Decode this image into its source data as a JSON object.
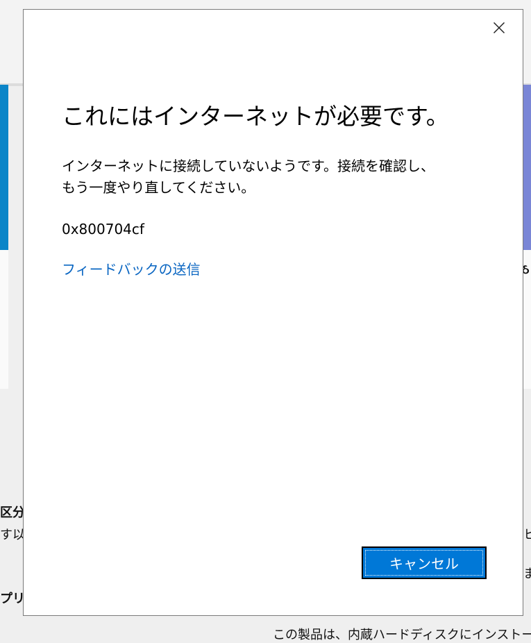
{
  "background": {
    "right_partial_glyph": "ઠ",
    "left_fragment_1": "区分",
    "left_fragment_2": "す以上",
    "left_fragment_3": "プリ",
    "right_fragment_1": "ヒ",
    "right_fragment_2": "ま",
    "bottom_text": "この製品は、内蔵ハードディスクにインストー"
  },
  "dialog": {
    "title": "これにはインターネットが必要です。",
    "message_line1": "インターネットに接続していないようです。接続を確認し、",
    "message_line2": "もう一度やり直してください。",
    "error_code": "0x800704cf",
    "feedback_link": "フィードバックの送信",
    "cancel_label": "キャンセル",
    "close_icon": "close-icon"
  },
  "colors": {
    "accent_button": "#0078d7",
    "link": "#0a66c2",
    "left_card_accent": "#0b85c8",
    "right_card_accent": "#7a86d6"
  }
}
